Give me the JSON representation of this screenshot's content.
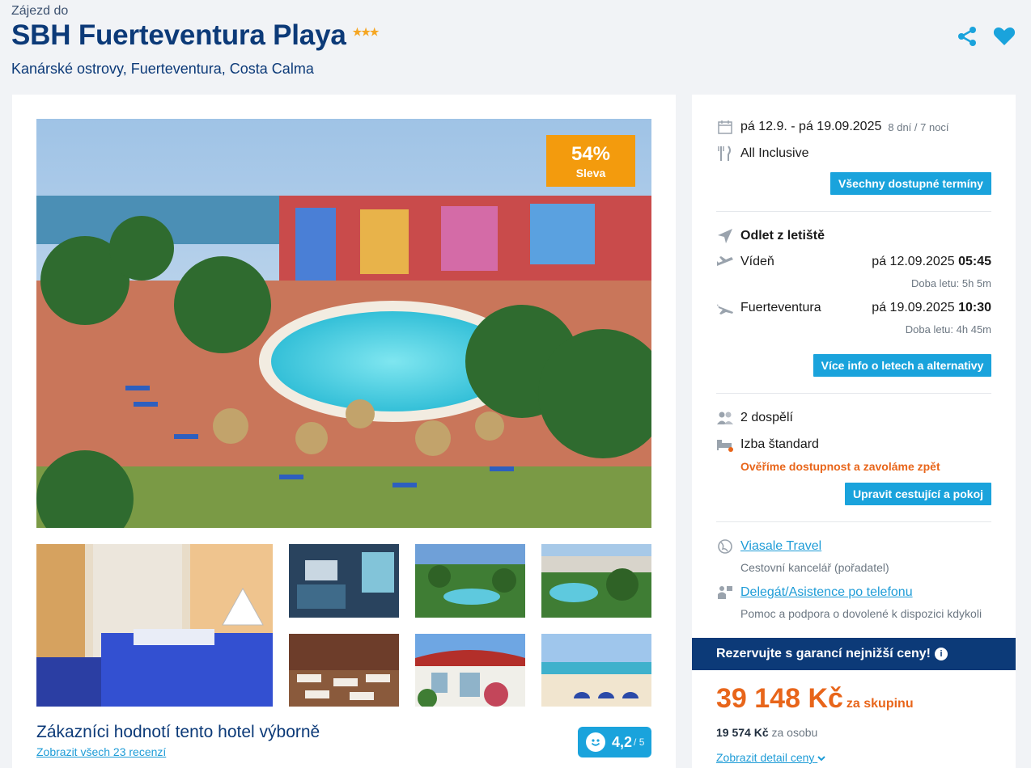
{
  "header": {
    "subtitle": "Zájezd do",
    "title": "SBH Fuerteventura Playa",
    "stars": "★★★",
    "location": "Kanárské ostrovy, Fuerteventura, Costa Calma",
    "share_icon": "share-icon",
    "favorite_icon": "heart-icon"
  },
  "gallery": {
    "sale_percent": "54%",
    "sale_label": "Sleva",
    "thumbnails": [
      "hotel-room",
      "interior-room",
      "garden-pool",
      "palm-pool",
      "restaurant",
      "hotel-entrance",
      "beach"
    ]
  },
  "rating": {
    "title": "Zákazníci hodnotí tento hotel výborně",
    "link": "Zobrazit všech 23 recenzí",
    "score": "4,2",
    "scale": "/ 5"
  },
  "booking": {
    "dates": "pá 12.9. - pá 19.09.2025",
    "duration": "8 dní / 7 nocí",
    "board": "All Inclusive",
    "terms_button": "Všechny dostupné termíny",
    "departure_title": "Odlet z letiště",
    "outbound": {
      "city": "Vídeň",
      "date": "pá 12.09.2025",
      "time": "05:45",
      "duration": "Doba letu: 5h 5m"
    },
    "inbound": {
      "city": "Fuerteventura",
      "date": "pá 19.09.2025",
      "time": "10:30",
      "duration": "Doba letu: 4h 45m"
    },
    "flights_button": "Více info o letech a alternativy",
    "travelers": "2 dospělí",
    "room": "Izba štandard",
    "availability_note": "Ověříme dostupnost a zavoláme zpět",
    "edit_button": "Upravit cestující a pokoj",
    "agency_link": "Viasale Travel",
    "agency_desc": "Cestovní kancelář (pořadatel)",
    "support_link": "Delegát/Asistence po telefonu",
    "support_desc": "Pomoc a podpora o dovolené k dispozici kdykoli",
    "promo": "Rezervujte s garancí nejnižší ceny!",
    "price": "39 148 Kč",
    "price_unit": "za skupinu",
    "per_person_price": "19 574 Kč",
    "per_person_label": "za osobu",
    "detail_link": "Zobrazit detail ceny"
  },
  "colors": {
    "brand_navy": "#0c3a78",
    "accent_blue": "#1aa3dc",
    "price_orange": "#e8651a",
    "sale_orange": "#f39b0d"
  }
}
